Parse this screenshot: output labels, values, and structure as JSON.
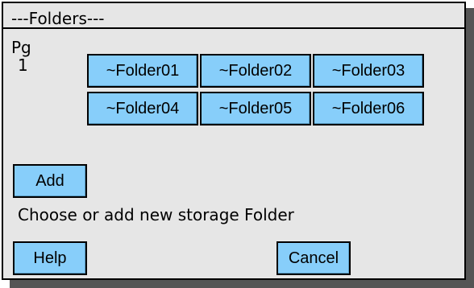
{
  "window": {
    "title": "---Folders---"
  },
  "pager": {
    "label": "Pg",
    "page": "1"
  },
  "folders": [
    {
      "label": "~Folder01"
    },
    {
      "label": "~Folder02"
    },
    {
      "label": "~Folder03"
    },
    {
      "label": "~Folder04"
    },
    {
      "label": "~Folder05"
    },
    {
      "label": "~Folder06"
    }
  ],
  "actions": {
    "add_label": "Add",
    "hint": "Choose or add new storage Folder",
    "help_label": "Help",
    "cancel_label": "Cancel"
  },
  "colors": {
    "button_bg": "#87cefa",
    "window_bg": "#e6e6e6"
  }
}
